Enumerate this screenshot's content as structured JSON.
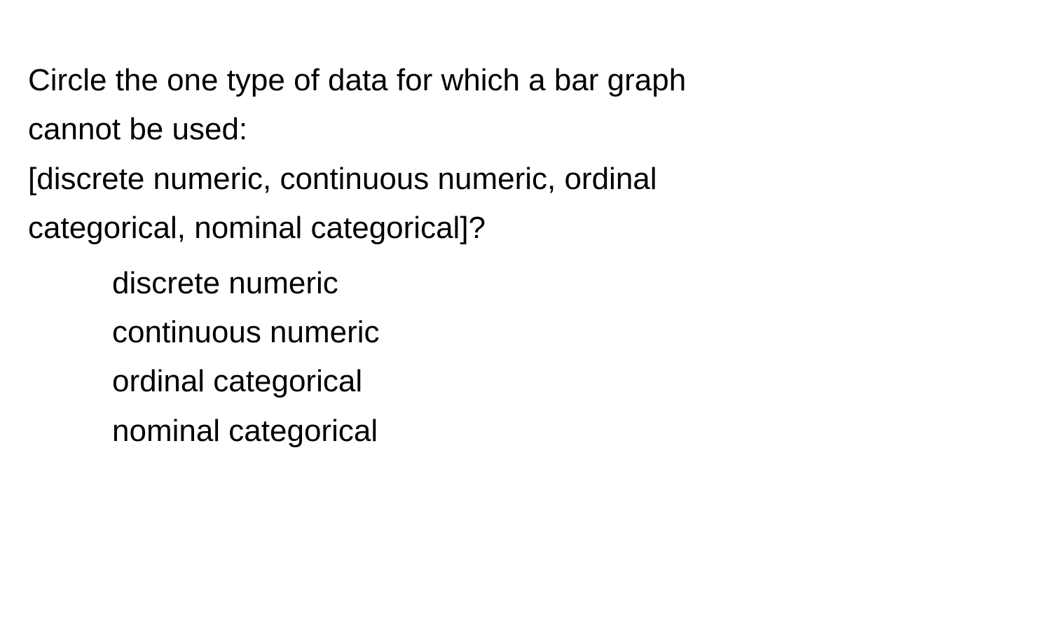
{
  "question": {
    "line1": "Circle the one type of data for which a bar graph",
    "line2": "cannot be used:",
    "line3": "[discrete numeric, continuous numeric, ordinal",
    "line4": "categorical, nominal categorical]?"
  },
  "options": {
    "item1": "discrete numeric",
    "item2": "continuous numeric",
    "item3": "ordinal categorical",
    "item4": "nominal categorical"
  }
}
